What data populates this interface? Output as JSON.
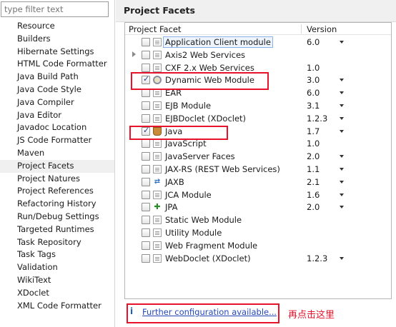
{
  "filter": {
    "placeholder": "type filter text"
  },
  "nav": {
    "items": [
      {
        "label": "Resource"
      },
      {
        "label": "Builders"
      },
      {
        "label": "Hibernate Settings"
      },
      {
        "label": "HTML Code Formatter"
      },
      {
        "label": "Java Build Path"
      },
      {
        "label": "Java Code Style"
      },
      {
        "label": "Java Compiler"
      },
      {
        "label": "Java Editor"
      },
      {
        "label": "Javadoc Location"
      },
      {
        "label": "JS Code Formatter"
      },
      {
        "label": "Maven"
      },
      {
        "label": "Project Facets",
        "selected": true
      },
      {
        "label": "Project Natures"
      },
      {
        "label": "Project References"
      },
      {
        "label": "Refactoring History"
      },
      {
        "label": "Run/Debug Settings"
      },
      {
        "label": "Targeted Runtimes"
      },
      {
        "label": "Task Repository"
      },
      {
        "label": "Task Tags"
      },
      {
        "label": "Validation"
      },
      {
        "label": "WikiText"
      },
      {
        "label": "XDoclet"
      },
      {
        "label": "XML Code Formatter"
      }
    ]
  },
  "page": {
    "title": "Project Facets"
  },
  "table": {
    "col_facet": "Project Facet",
    "col_version": "Version",
    "rows": [
      {
        "name": "Application Client module",
        "version": "6.0",
        "checked": false,
        "icon": "page-icon",
        "dropdown": true
      },
      {
        "name": "Axis2 Web Services",
        "version": "",
        "checked": false,
        "icon": "page-icon",
        "dropdown": false,
        "expandable": true
      },
      {
        "name": "CXF 2.x Web Services",
        "version": "1.0",
        "checked": false,
        "icon": "page-icon",
        "dropdown": false
      },
      {
        "name": "Dynamic Web Module",
        "version": "3.0",
        "checked": true,
        "icon": "web-module-icon",
        "dropdown": true
      },
      {
        "name": "EAR",
        "version": "6.0",
        "checked": false,
        "icon": "page-icon",
        "dropdown": true
      },
      {
        "name": "EJB Module",
        "version": "3.1",
        "checked": false,
        "icon": "page-icon",
        "dropdown": true
      },
      {
        "name": "EJBDoclet (XDoclet)",
        "version": "1.2.3",
        "checked": false,
        "icon": "page-icon",
        "dropdown": true
      },
      {
        "name": "Java",
        "version": "1.7",
        "checked": true,
        "icon": "java-icon",
        "dropdown": true
      },
      {
        "name": "JavaScript",
        "version": "1.0",
        "checked": false,
        "icon": "page-icon",
        "dropdown": false
      },
      {
        "name": "JavaServer Faces",
        "version": "2.0",
        "checked": false,
        "icon": "page-icon",
        "dropdown": true
      },
      {
        "name": "JAX-RS (REST Web Services)",
        "version": "1.1",
        "checked": false,
        "icon": "page-icon",
        "dropdown": true
      },
      {
        "name": "JAXB",
        "version": "2.1",
        "checked": false,
        "icon": "jaxb-icon",
        "dropdown": true
      },
      {
        "name": "JCA Module",
        "version": "1.6",
        "checked": false,
        "icon": "page-icon",
        "dropdown": true
      },
      {
        "name": "JPA",
        "version": "2.0",
        "checked": false,
        "icon": "jpa-icon",
        "dropdown": true
      },
      {
        "name": "Static Web Module",
        "version": "",
        "checked": false,
        "icon": "page-icon",
        "dropdown": false
      },
      {
        "name": "Utility Module",
        "version": "",
        "checked": false,
        "icon": "page-icon",
        "dropdown": false
      },
      {
        "name": "Web Fragment Module",
        "version": "",
        "checked": false,
        "icon": "page-icon",
        "dropdown": false
      },
      {
        "name": "WebDoclet (XDoclet)",
        "version": "1.2.3",
        "checked": false,
        "icon": "page-icon",
        "dropdown": true
      }
    ]
  },
  "info": {
    "link_text": "Further configuration available..."
  },
  "note": {
    "text": "再点击这里"
  },
  "colors": {
    "highlight": "#e8132a",
    "link": "#2448b8"
  }
}
